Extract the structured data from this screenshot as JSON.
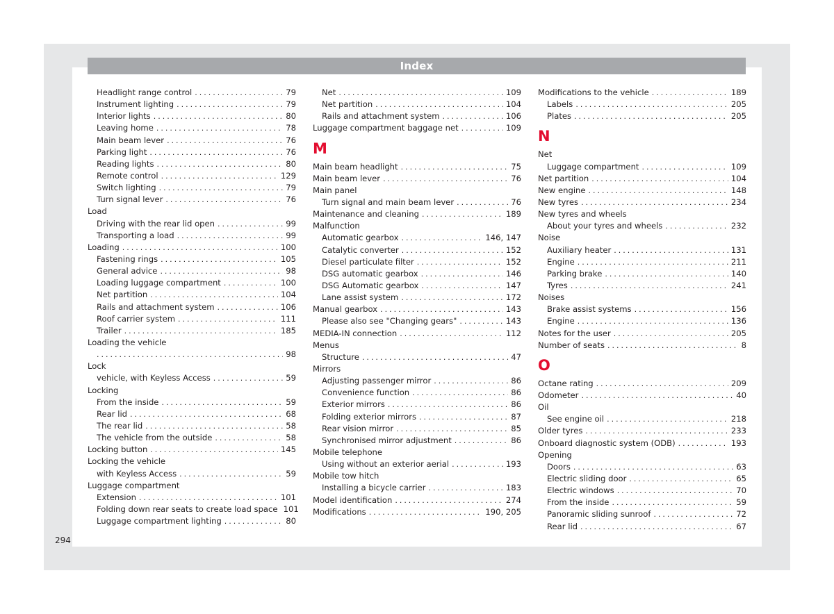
{
  "header": {
    "title": "Index"
  },
  "page_number": "294",
  "accent_color": "#e30d2f",
  "columns": [
    {
      "entries": [
        {
          "type": "sub",
          "label": "Headlight range control",
          "pages": "79"
        },
        {
          "type": "sub",
          "label": "Instrument lighting",
          "pages": "79"
        },
        {
          "type": "sub",
          "label": "Interior lights",
          "pages": "80"
        },
        {
          "type": "sub",
          "label": "Leaving home",
          "pages": "78"
        },
        {
          "type": "sub",
          "label": "Main beam lever",
          "pages": "76"
        },
        {
          "type": "sub",
          "label": "Parking light",
          "pages": "76"
        },
        {
          "type": "sub",
          "label": "Reading lights",
          "pages": "80"
        },
        {
          "type": "sub",
          "label": "Remote control",
          "pages": "129"
        },
        {
          "type": "sub",
          "label": "Switch lighting",
          "pages": "79"
        },
        {
          "type": "sub",
          "label": "Turn signal lever",
          "pages": "76"
        },
        {
          "type": "main",
          "label": "Load",
          "pages": ""
        },
        {
          "type": "sub",
          "label": "Driving with the rear lid open",
          "pages": "99"
        },
        {
          "type": "sub",
          "label": "Transporting a load",
          "pages": "99"
        },
        {
          "type": "main",
          "label": "Loading",
          "pages": "100"
        },
        {
          "type": "sub",
          "label": "Fastening rings",
          "pages": "105"
        },
        {
          "type": "sub",
          "label": "General advice",
          "pages": "98"
        },
        {
          "type": "sub",
          "label": "Loading luggage compartment",
          "pages": "100"
        },
        {
          "type": "sub",
          "label": "Net partition",
          "pages": "104"
        },
        {
          "type": "sub",
          "label": "Rails and attachment system",
          "pages": "106"
        },
        {
          "type": "sub",
          "label": "Roof carrier system",
          "pages": "111"
        },
        {
          "type": "sub",
          "label": "Trailer",
          "pages": "185"
        },
        {
          "type": "main",
          "label": "Loading the vehicle",
          "pages": ""
        },
        {
          "type": "sub",
          "label": "",
          "pages": "98"
        },
        {
          "type": "main",
          "label": "Lock",
          "pages": ""
        },
        {
          "type": "sub",
          "label": "vehicle, with Keyless Access",
          "pages": "59"
        },
        {
          "type": "main",
          "label": "Locking",
          "pages": ""
        },
        {
          "type": "sub",
          "label": "From the inside",
          "pages": "59"
        },
        {
          "type": "sub",
          "label": "Rear lid",
          "pages": "68"
        },
        {
          "type": "sub",
          "label": "The rear lid",
          "pages": "58"
        },
        {
          "type": "sub",
          "label": "The vehicle from the outside",
          "pages": "58"
        },
        {
          "type": "main",
          "label": "Locking button",
          "pages": "145"
        },
        {
          "type": "main",
          "label": "Locking the vehicle",
          "pages": ""
        },
        {
          "type": "sub",
          "label": "with Keyless Access",
          "pages": "59"
        },
        {
          "type": "main",
          "label": "Luggage compartment",
          "pages": ""
        },
        {
          "type": "sub",
          "label": "Extension",
          "pages": "101"
        },
        {
          "type": "sub",
          "label": "Folding down rear seats to create load space",
          "pages": "101"
        },
        {
          "type": "sub",
          "label": "Luggage compartment lighting",
          "pages": "80"
        }
      ]
    },
    {
      "entries": [
        {
          "type": "sub",
          "label": "Net",
          "pages": "109"
        },
        {
          "type": "sub",
          "label": "Net partition",
          "pages": "104"
        },
        {
          "type": "sub",
          "label": "Rails and attachment system",
          "pages": "106"
        },
        {
          "type": "main",
          "label": "Luggage compartment baggage net",
          "pages": "109"
        },
        {
          "type": "letter",
          "label": "M"
        },
        {
          "type": "main",
          "label": "Main beam headlight",
          "pages": "75"
        },
        {
          "type": "main",
          "label": "Main beam lever",
          "pages": "76"
        },
        {
          "type": "main",
          "label": "Main panel",
          "pages": ""
        },
        {
          "type": "sub",
          "label": "Turn signal and main beam lever",
          "pages": "76"
        },
        {
          "type": "main",
          "label": "Maintenance and cleaning",
          "pages": "189"
        },
        {
          "type": "main",
          "label": "Malfunction",
          "pages": ""
        },
        {
          "type": "sub",
          "label": "Automatic gearbox",
          "pages": "146, 147"
        },
        {
          "type": "sub",
          "label": "Catalytic converter",
          "pages": "152"
        },
        {
          "type": "sub",
          "label": "Diesel particulate filter",
          "pages": "152"
        },
        {
          "type": "sub",
          "label": "DSG automatic gearbox",
          "pages": "146"
        },
        {
          "type": "sub",
          "label": "DSG Automatic gearbox",
          "pages": "147"
        },
        {
          "type": "sub",
          "label": "Lane assist system",
          "pages": "172"
        },
        {
          "type": "main",
          "label": "Manual gearbox",
          "pages": "143"
        },
        {
          "type": "sub",
          "label": "Please also see \"Changing gears\"",
          "pages": "143"
        },
        {
          "type": "main",
          "label": "MEDIA-IN connection",
          "pages": "112"
        },
        {
          "type": "main",
          "label": "Menus",
          "pages": ""
        },
        {
          "type": "sub",
          "label": "Structure",
          "pages": "47"
        },
        {
          "type": "main",
          "label": "Mirrors",
          "pages": ""
        },
        {
          "type": "sub",
          "label": "Adjusting passenger mirror",
          "pages": "86"
        },
        {
          "type": "sub",
          "label": "Convenience function",
          "pages": "86"
        },
        {
          "type": "sub",
          "label": "Exterior mirrors",
          "pages": "86"
        },
        {
          "type": "sub",
          "label": "Folding exterior mirrors",
          "pages": "87"
        },
        {
          "type": "sub",
          "label": "Rear vision mirror",
          "pages": "85"
        },
        {
          "type": "sub",
          "label": "Synchronised mirror adjustment",
          "pages": "86"
        },
        {
          "type": "main",
          "label": "Mobile telephone",
          "pages": ""
        },
        {
          "type": "sub",
          "label": "Using without an exterior aerial",
          "pages": "193"
        },
        {
          "type": "main",
          "label": "Mobile tow hitch",
          "pages": ""
        },
        {
          "type": "sub",
          "label": "Installing a bicycle carrier",
          "pages": "183"
        },
        {
          "type": "main",
          "label": "Model identification",
          "pages": "274"
        },
        {
          "type": "main",
          "label": "Modifications",
          "pages": "190, 205"
        }
      ]
    },
    {
      "entries": [
        {
          "type": "main",
          "label": "Modifications to the vehicle",
          "pages": "189"
        },
        {
          "type": "sub",
          "label": "Labels",
          "pages": "205"
        },
        {
          "type": "sub",
          "label": "Plates",
          "pages": "205"
        },
        {
          "type": "letter",
          "label": "N"
        },
        {
          "type": "main",
          "label": "Net",
          "pages": ""
        },
        {
          "type": "sub",
          "label": "Luggage compartment",
          "pages": "109"
        },
        {
          "type": "main",
          "label": "Net partition",
          "pages": "104"
        },
        {
          "type": "main",
          "label": "New engine",
          "pages": "148"
        },
        {
          "type": "main",
          "label": "New tyres",
          "pages": "234"
        },
        {
          "type": "main",
          "label": "New tyres and wheels",
          "pages": ""
        },
        {
          "type": "sub",
          "label": "About your tyres and wheels",
          "pages": "232"
        },
        {
          "type": "main",
          "label": "Noise",
          "pages": ""
        },
        {
          "type": "sub",
          "label": "Auxiliary heater",
          "pages": "131"
        },
        {
          "type": "sub",
          "label": "Engine",
          "pages": "211"
        },
        {
          "type": "sub",
          "label": "Parking brake",
          "pages": "140"
        },
        {
          "type": "sub",
          "label": "Tyres",
          "pages": "241"
        },
        {
          "type": "main",
          "label": "Noises",
          "pages": ""
        },
        {
          "type": "sub",
          "label": "Brake assist systems",
          "pages": "156"
        },
        {
          "type": "sub",
          "label": "Engine",
          "pages": "136"
        },
        {
          "type": "main",
          "label": "Notes for the user",
          "pages": "205"
        },
        {
          "type": "main",
          "label": "Number of seats",
          "pages": "8"
        },
        {
          "type": "letter",
          "label": "O"
        },
        {
          "type": "main",
          "label": "Octane rating",
          "pages": "209"
        },
        {
          "type": "main",
          "label": "Odometer",
          "pages": "40"
        },
        {
          "type": "main",
          "label": "Oil",
          "pages": ""
        },
        {
          "type": "sub",
          "label": "See engine oil",
          "pages": "218"
        },
        {
          "type": "main",
          "label": "Older tyres",
          "pages": "233"
        },
        {
          "type": "main",
          "label": "Onboard diagnostic system (ODB)",
          "pages": "193"
        },
        {
          "type": "main",
          "label": "Opening",
          "pages": ""
        },
        {
          "type": "sub",
          "label": "Doors",
          "pages": "63"
        },
        {
          "type": "sub",
          "label": "Electric sliding door",
          "pages": "65"
        },
        {
          "type": "sub",
          "label": "Electric windows",
          "pages": "70"
        },
        {
          "type": "sub",
          "label": "From the inside",
          "pages": "59"
        },
        {
          "type": "sub",
          "label": "Panoramic sliding sunroof",
          "pages": "72"
        },
        {
          "type": "sub",
          "label": "Rear lid",
          "pages": "67"
        }
      ]
    }
  ]
}
